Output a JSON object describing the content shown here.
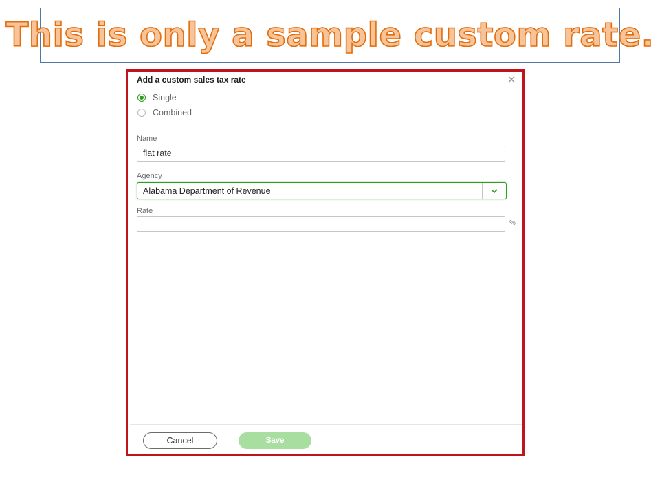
{
  "banner": {
    "text": "This is only a sample custom rate."
  },
  "dialog": {
    "title": "Add a custom sales tax rate",
    "close_icon": "close-icon",
    "rate_type": {
      "options": [
        {
          "label": "Single",
          "selected": true
        },
        {
          "label": "Combined",
          "selected": false
        }
      ]
    },
    "name": {
      "label": "Name",
      "value": "flat rate"
    },
    "agency": {
      "label": "Agency",
      "value": "Alabama Department of Revenue",
      "toggle_icon": "chevron-down-icon"
    },
    "rate": {
      "label": "Rate",
      "value": "",
      "suffix": "%"
    },
    "buttons": {
      "cancel": "Cancel",
      "save": "Save"
    }
  },
  "colors": {
    "accent_green": "#2ca01c",
    "save_disabled": "#a9dea1",
    "frame_red": "#c0141c",
    "banner_fill": "#f7c49a",
    "banner_stroke": "#e46c0a"
  }
}
